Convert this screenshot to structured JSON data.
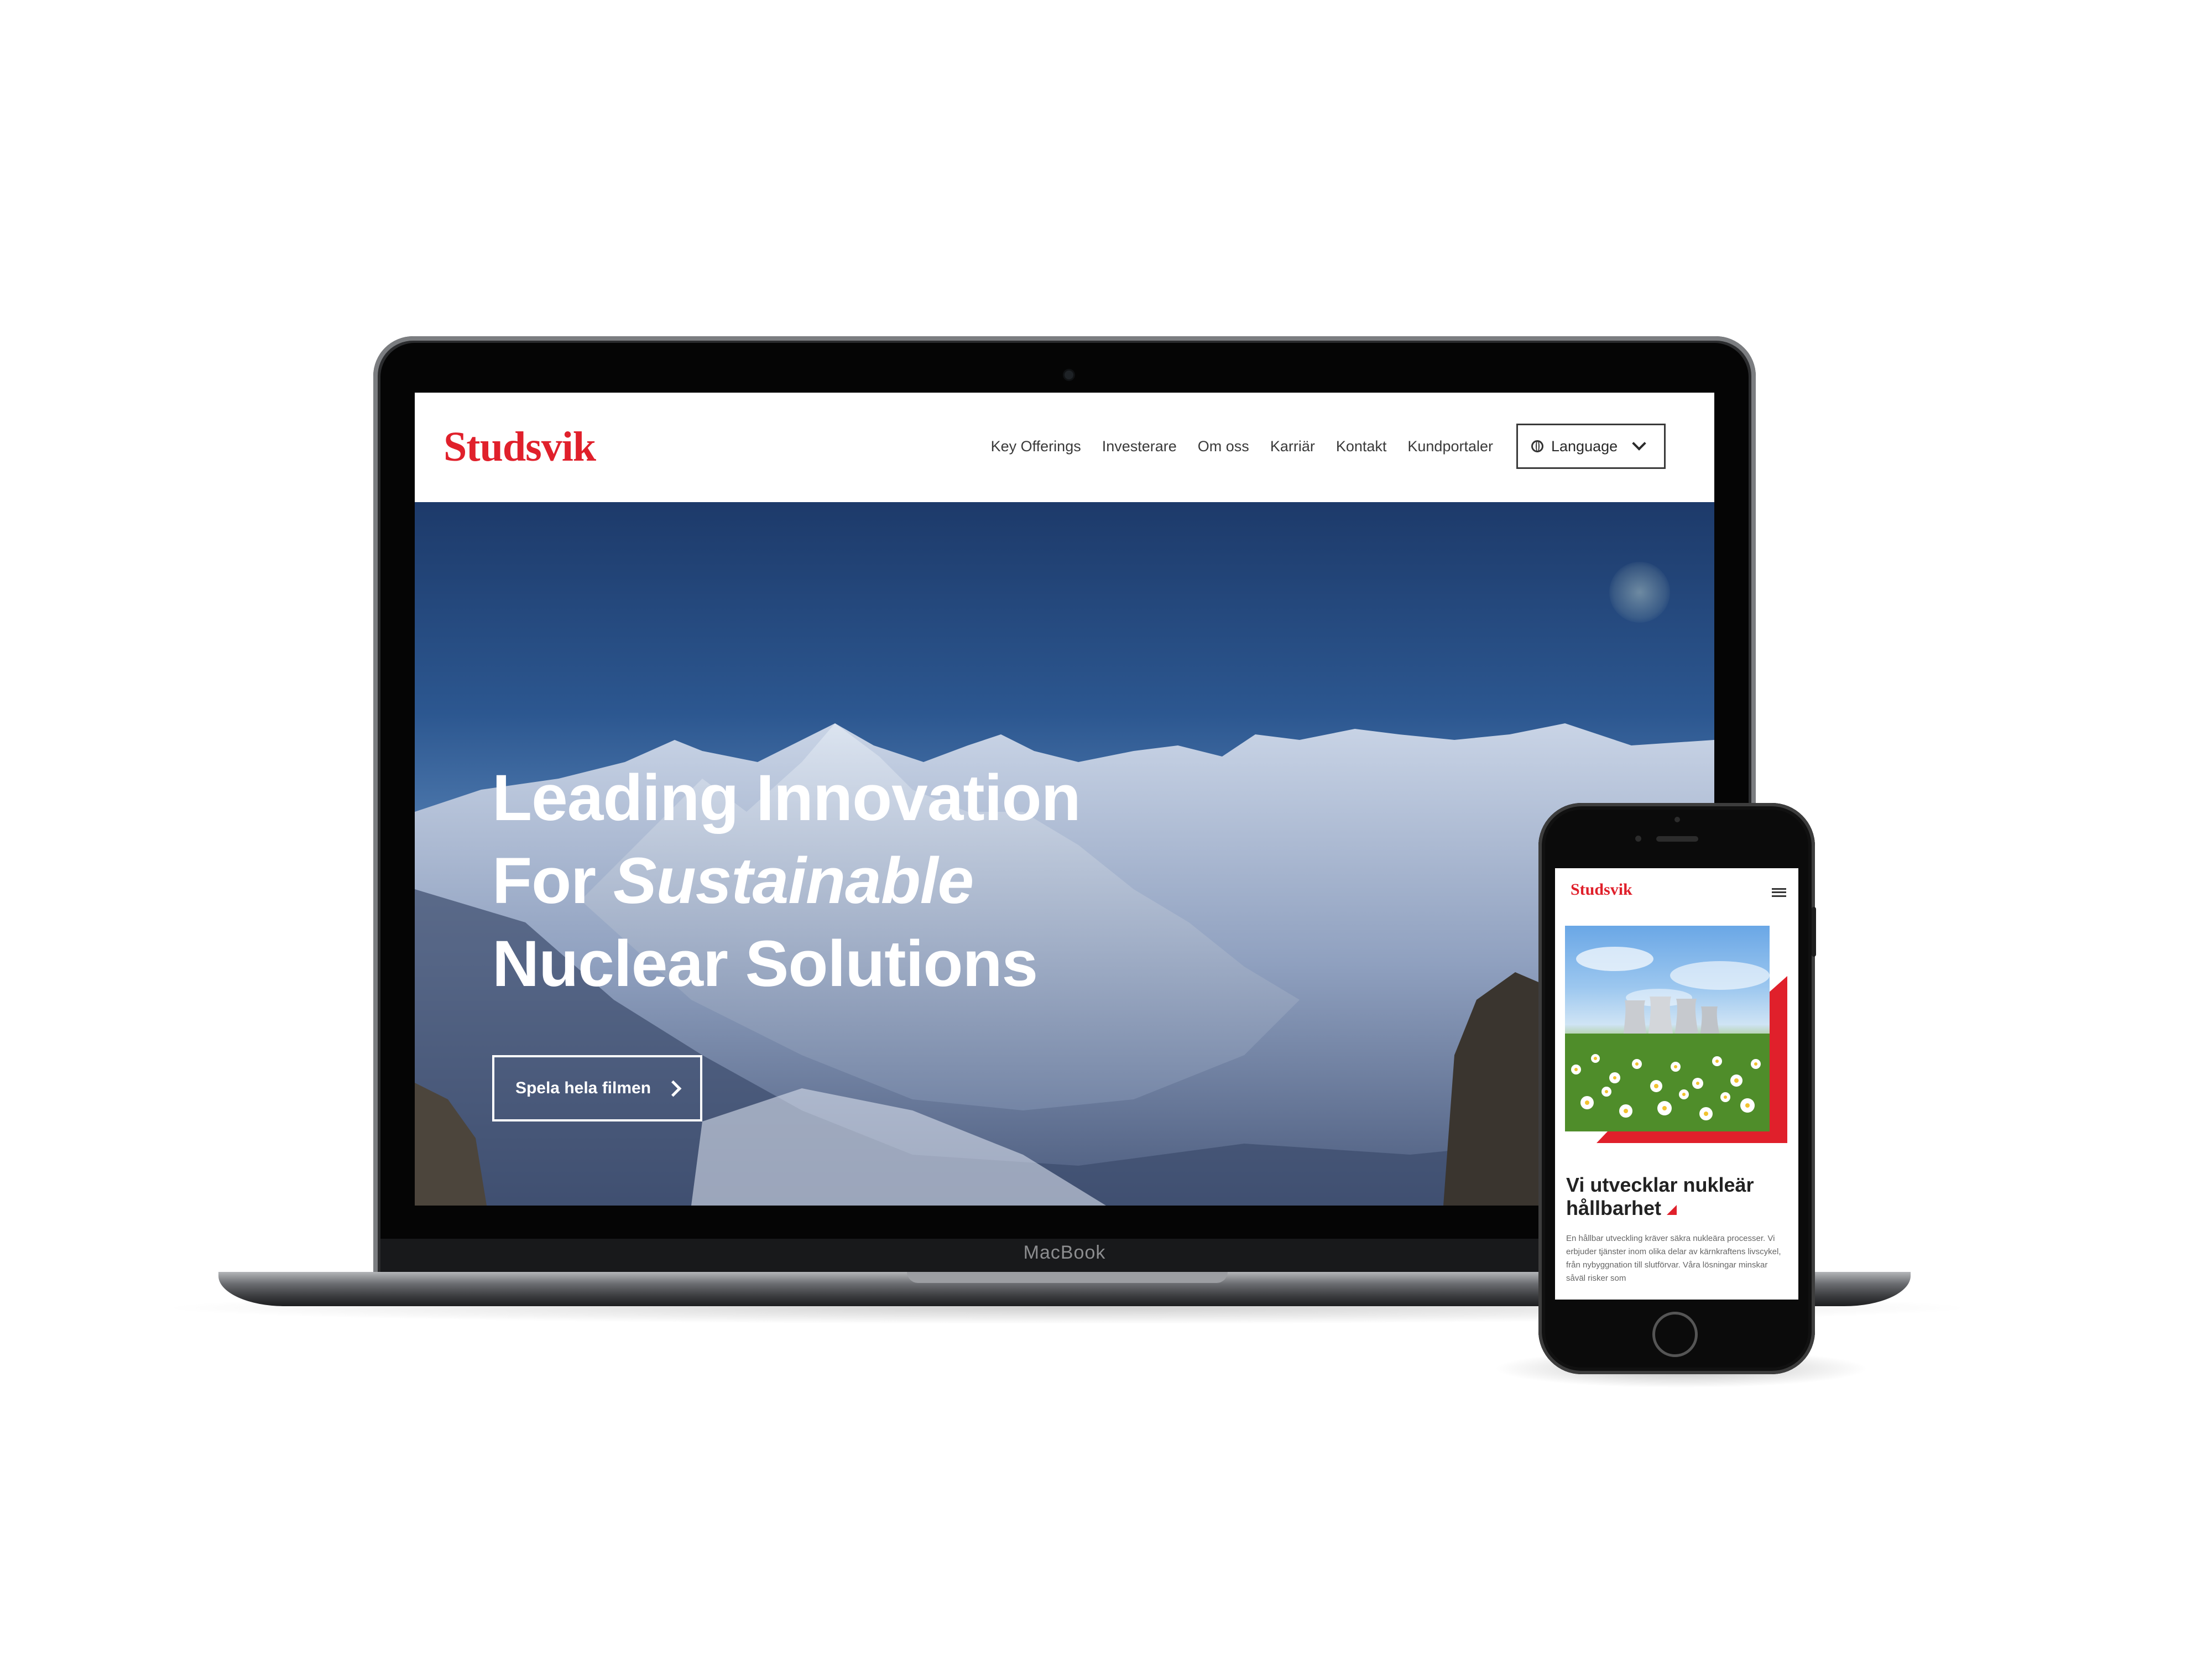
{
  "device_frame": {
    "laptop_label": "MacBook"
  },
  "desktop": {
    "logo": "Studsvik",
    "nav": [
      "Key Offerings",
      "Investerare",
      "Om oss",
      "Karriär",
      "Kontakt",
      "Kundportaler"
    ],
    "language_select": "Language",
    "hero": {
      "title_line1": "Leading Innovation",
      "title_line2_pre": "For ",
      "title_line2_em": "Sustainable",
      "title_line3": "Nuclear Solutions",
      "cta_label": "Spela hela filmen"
    }
  },
  "mobile": {
    "logo": "Studsvik",
    "heading": "Vi utvecklar nukleär hållbarhet",
    "body": "En hållbar utveckling kräver säkra nukleära processer. Vi erbjuder tjänster inom olika delar av kärnkraftens livscykel, från nybyggnation till slutförvar. Våra lösningar minskar såväl risker som"
  },
  "colors": {
    "brand_red": "#e0202b",
    "text_dark": "#3a3a3a"
  }
}
